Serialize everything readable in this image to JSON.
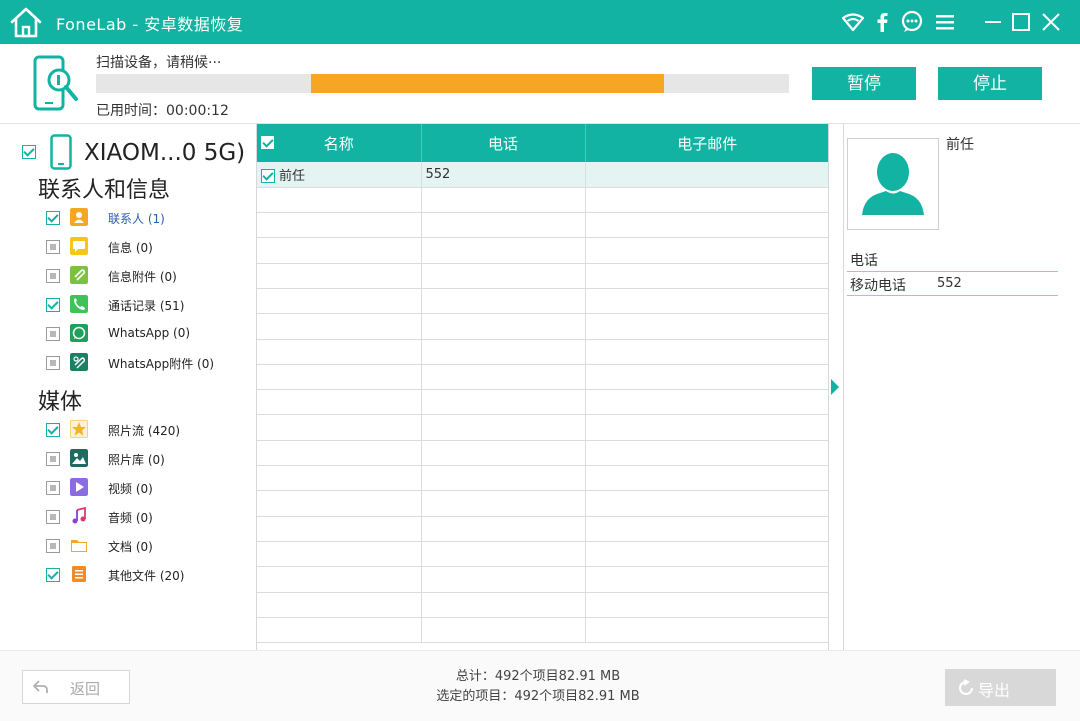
{
  "app": {
    "title": "FoneLab - 安卓数据恢复",
    "brand_color": "#12b3a2",
    "titlebar_icons": [
      "wifi-icon",
      "facebook-icon",
      "chat-icon",
      "menu-icon",
      "minimize-icon",
      "maximize-icon",
      "close-icon"
    ]
  },
  "scan": {
    "status": "扫描设备，请稍候···",
    "elapsed": "已用时间：00:00:12",
    "progress_fill_start": 0.31,
    "progress_fill_end": 0.82,
    "progress_color": "#f5a623",
    "pause_label": "暂停",
    "stop_label": "停止"
  },
  "sidebar": {
    "device_name": "XIAOM...0 5G)",
    "sections": [
      {
        "title": "联系人和信息",
        "items": [
          {
            "label": "联系人 (1)",
            "checked": true,
            "icon": "contacts-icon",
            "color": "#f5a623",
            "active": true
          },
          {
            "label": "信息 (0)",
            "checked": false,
            "icon": "message-icon",
            "color": "#f5c518"
          },
          {
            "label": "信息附件 (0)",
            "checked": false,
            "icon": "attachment-icon",
            "color": "#7cc242"
          },
          {
            "label": "通话记录 (51)",
            "checked": true,
            "icon": "call-log-icon",
            "color": "#3fc25a"
          },
          {
            "label": "WhatsApp (0)",
            "checked": false,
            "icon": "whatsapp-icon",
            "color": "#1fa05a"
          },
          {
            "label": "WhatsApp附件 (0)",
            "checked": false,
            "icon": "whatsapp-attachment-icon",
            "color": "#1d7f64"
          }
        ]
      },
      {
        "title": "媒体",
        "items": [
          {
            "label": "照片流 (420)",
            "checked": true,
            "icon": "photo-stream-icon",
            "color": "#f5b51e"
          },
          {
            "label": "照片库 (0)",
            "checked": false,
            "icon": "photo-library-icon",
            "color": "#1f6b60"
          },
          {
            "label": "视频 (0)",
            "checked": false,
            "icon": "video-icon",
            "color": "#8a6ce0"
          },
          {
            "label": "音频 (0)",
            "checked": false,
            "icon": "audio-icon",
            "color": "#d23f6a"
          },
          {
            "label": "文档 (0)",
            "checked": false,
            "icon": "document-icon",
            "color": "#f5a623"
          },
          {
            "label": "其他文件 (20)",
            "checked": true,
            "icon": "other-files-icon",
            "color": "#f08a2a"
          }
        ]
      }
    ]
  },
  "table": {
    "columns": [
      "名称",
      "电话",
      "电子邮件"
    ],
    "rows": [
      {
        "name": "前任",
        "phone": "552",
        "email": "",
        "checked": true
      }
    ],
    "empty_rows": 18
  },
  "detail": {
    "name": "前任",
    "phone_heading": "电话",
    "mobile_label": "移动电话",
    "mobile_value": "552"
  },
  "footer": {
    "back_label": "返回",
    "total": "总计：492个项目82.91 MB",
    "selected": "选定的项目：492个项目82.91 MB",
    "export_label": "导出"
  }
}
